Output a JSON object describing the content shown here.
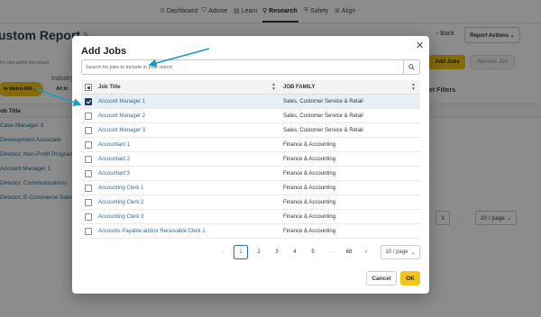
{
  "nav": [
    {
      "icon": "⊙",
      "icon_name": "dashboard-icon",
      "label": "Dashboard",
      "active": false
    },
    {
      "icon": "⛉",
      "icon_name": "advise-icon",
      "label": "Advise",
      "active": false
    },
    {
      "icon": "▤",
      "icon_name": "learn-icon",
      "label": "Learn",
      "active": false
    },
    {
      "icon": "⚲",
      "icon_name": "research-icon",
      "label": "Research",
      "active": true
    },
    {
      "icon": "⛨",
      "icon_name": "safety-icon",
      "label": "Safety",
      "active": false
    },
    {
      "icon": "⊞",
      "icon_name": "align-icon",
      "label": "Align",
      "active": false
    }
  ],
  "page": {
    "title": "ustom Report",
    "back_label": "‹ Back",
    "report_actions_label": "Report Actions ⌄",
    "search_hint": "for jobs within this report",
    "industry_label": "Industry",
    "metro_chip_label": "le Metro-WA ⌄",
    "all_chip_label": "All In",
    "add_jobs_label": "Add Jobs",
    "remove_job_label": "Remove Job",
    "reset_filters_label": "et Filters",
    "table_header": "ob Title",
    "rows": [
      "Case Manager 3",
      "Development Associate",
      "Director, Non-Profit Program",
      "Account Manager 1",
      "Director, Communications",
      "Director, E-Commerce Sales"
    ],
    "pager_page": "1",
    "pager_next": "›",
    "pager_size": "20 / page ⌄"
  },
  "modal": {
    "title": "Add Jobs",
    "close": "✕",
    "search_placeholder": "Search for jobs to include in your report",
    "columns": {
      "title": "Job Title",
      "family": "JOB FAMILY"
    },
    "rows": [
      {
        "title": "Account Manager 1",
        "family": "Sales, Customer Service & Retail",
        "checked": true
      },
      {
        "title": "Account Manager 2",
        "family": "Sales, Customer Service & Retail",
        "checked": false
      },
      {
        "title": "Account Manager 3",
        "family": "Sales, Customer Service & Retail",
        "checked": false
      },
      {
        "title": "Accountant 1",
        "family": "Finance & Accounting",
        "checked": false
      },
      {
        "title": "Accountant 2",
        "family": "Finance & Accounting",
        "checked": false
      },
      {
        "title": "Accountant 3",
        "family": "Finance & Accounting",
        "checked": false
      },
      {
        "title": "Accounting Clerk 1",
        "family": "Finance & Accounting",
        "checked": false
      },
      {
        "title": "Accounting Clerk 2",
        "family": "Finance & Accounting",
        "checked": false
      },
      {
        "title": "Accounting Clerk 3",
        "family": "Finance & Accounting",
        "checked": false
      },
      {
        "title": "Accounts Payable and/or Receivable Clerk 1",
        "family": "Finance & Accounting",
        "checked": false
      }
    ],
    "pagination": {
      "prev": "‹",
      "pages": [
        "1",
        "2",
        "3",
        "4",
        "5"
      ],
      "ellipsis": "···",
      "last": "68",
      "next": "›",
      "current": "1",
      "page_size": "10 / page"
    },
    "cancel_label": "Cancel",
    "ok_label": "OK"
  },
  "colors": {
    "accent": "#f0c419",
    "link": "#2a6e9b",
    "annotation_arrow": "#1a9bbf",
    "checkbox_checked": "#1d3b5a"
  }
}
